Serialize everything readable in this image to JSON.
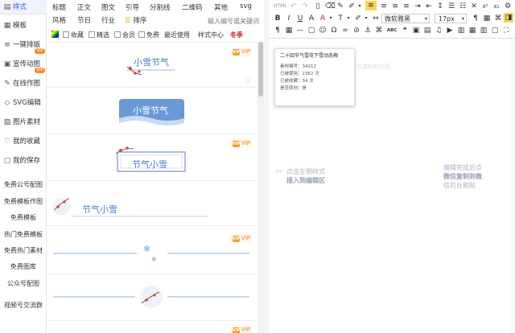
{
  "sidebar": {
    "items": [
      {
        "label": "样式",
        "icon": "style-icon"
      },
      {
        "label": "模板",
        "icon": "template-icon"
      },
      {
        "label": "一键排版",
        "icon": "layout-icon",
        "badge": "VIP"
      },
      {
        "label": "宣传动图",
        "icon": "gif-icon",
        "badge": "VIP"
      },
      {
        "label": "在线作图",
        "icon": "draw-icon"
      },
      {
        "label": "SVG编辑",
        "icon": "svg-icon"
      },
      {
        "label": "图片素材",
        "icon": "image-icon"
      },
      {
        "label": "我的收藏",
        "icon": "heart-icon"
      },
      {
        "label": "我的保存",
        "icon": "save-icon"
      }
    ],
    "promos": [
      "免费公号配图",
      "免费模板作图",
      "免费模板",
      "热门免费模板",
      "免费热门素材",
      "免费图库",
      "公众号配图",
      "视频号交流群"
    ]
  },
  "categories": {
    "row1": [
      "标题",
      "正文",
      "图文",
      "引导",
      "分割线",
      "二维码",
      "其他",
      "svg"
    ],
    "row2": [
      "风格",
      "节日",
      "行业",
      "排序"
    ],
    "search_placeholder": "输入编号或关键词",
    "filters": [
      "收藏",
      "精选",
      "会员",
      "免费"
    ],
    "recent": "最近使用",
    "center": "样式中心",
    "winter": "冬季"
  },
  "cards": [
    {
      "title": "小雪节气",
      "vip": "VIP"
    },
    {
      "title": "小雪节气"
    },
    {
      "title": "节气小雪",
      "vip": "VIP"
    },
    {
      "title": "节气小雪"
    },
    {
      "vip": "VIP"
    },
    {},
    {
      "vip": "VIP"
    }
  ],
  "toolbar": {
    "font": "微软雅黑",
    "size": "17px",
    "html_label": "HTML"
  },
  "popup": {
    "title": "二十四节气雪花下雪动态梅",
    "id": "素材编号：34212",
    "used": "已被使用：2362 次",
    "fav": "已被收藏：34 次",
    "source": "是否原创：是"
  },
  "editor": {
    "hint_left_1": "点击左侧样式",
    "hint_left_2": "插入到编辑区",
    "hint_right_1": "编辑完成后点",
    "hint_right_2": "微信复制到微",
    "hint_right_3": "信后台粘贴",
    "ghost": "从这里开始写正文或粘贴内容"
  },
  "colors": {
    "accent": "#4a7bd4",
    "vip": "#ff8a2a",
    "winter": "#e02020",
    "card_blue": "#6a9ad6"
  }
}
